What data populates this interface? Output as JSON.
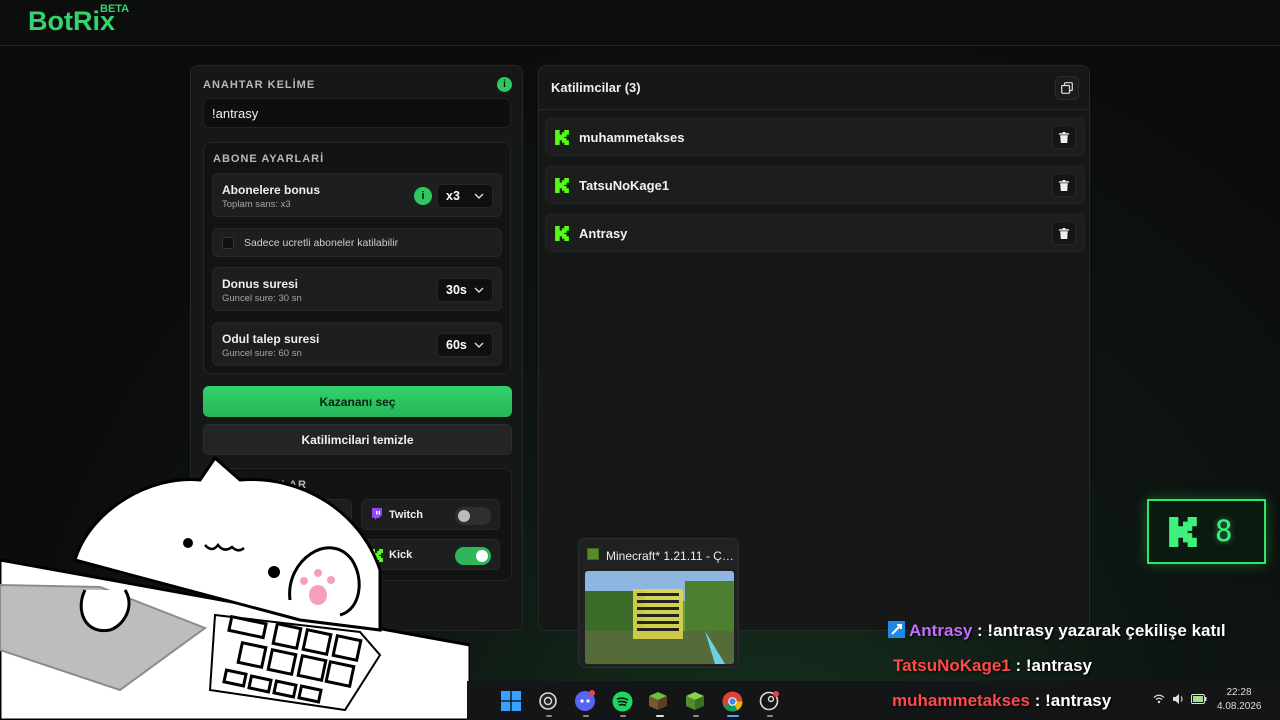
{
  "app": {
    "name": "BotRix",
    "badge": "BETA"
  },
  "keyword_section": {
    "title": "ANAHTAR KELİME",
    "value": "!antrasy",
    "info": "i"
  },
  "subscriber_settings": {
    "title": "ABONE AYARLARİ",
    "bonus": {
      "title": "Abonelere bonus",
      "subtitle": "Toplam sans: x3",
      "value": "x3",
      "info": "i"
    },
    "paid_only": {
      "label": "Sadece ucretli aboneler katilabilir",
      "checked": false
    },
    "spin_time": {
      "title": "Donus suresi",
      "subtitle": "Guncel sure: 30 sn",
      "value": "30s"
    },
    "claim_time": {
      "title": "Odul talep suresi",
      "subtitle": "Guncel sure: 60 sn",
      "value": "60s"
    }
  },
  "buttons": {
    "pick_winner": "Kazananı seç",
    "clear_participants": "Katilimcilari temizle"
  },
  "platforms": {
    "title": "PLATFORMLAR",
    "twitch": {
      "label": "Twitch",
      "enabled": false
    },
    "kick": {
      "label": "Kick",
      "enabled": true
    }
  },
  "participants": {
    "title": "Katilimcilar (3)",
    "items": [
      {
        "name": "muhammetakses",
        "platform": "kick-icon"
      },
      {
        "name": "TatsuNoKage1",
        "platform": "kick-icon"
      },
      {
        "name": "Antrasy",
        "platform": "kick-icon"
      }
    ]
  },
  "kick_counter": {
    "value": "8"
  },
  "chat": [
    {
      "user": "Antrasy",
      "sep": " : ",
      "message": "!antrasy yazarak çekilişe katıl",
      "user_color": "#c56bff"
    },
    {
      "user": "TatsuNoKage1",
      "sep": " : ",
      "message": "!antrasy",
      "user_color": "#ff4a4a"
    },
    {
      "user": "muhammetakses",
      "sep": " : ",
      "message": "!antrasy",
      "user_color": "#ff4a4a"
    }
  ],
  "taskbar_preview": {
    "title": "Minecraft* 1.21.11 - Çok..."
  },
  "clock": {
    "time": "22:28",
    "date": "4.08.2026"
  },
  "colors": {
    "accent": "#2ec85e",
    "kick_green": "#53fc18",
    "panel": "#161717"
  }
}
